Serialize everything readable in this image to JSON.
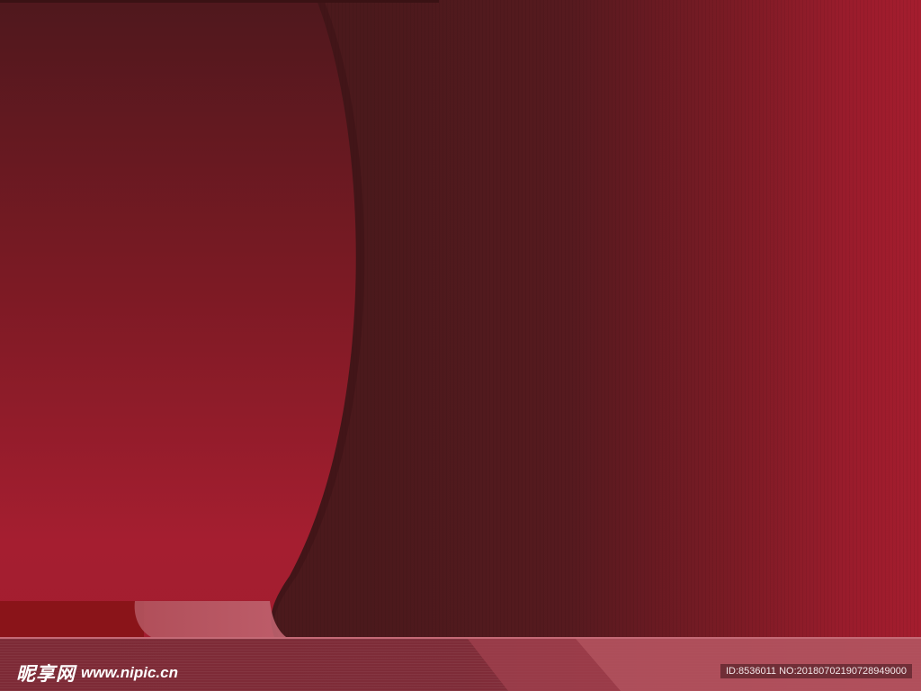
{
  "watermark": {
    "logo_text": "昵享网",
    "url_text": "www.nipic.cn"
  },
  "id_badge": {
    "text": "ID:8536011 NO:20180702190728949000"
  },
  "colors": {
    "curve_panel_top": "#4f181d",
    "curve_panel_bottom": "#a51e30",
    "stripe_field_left": "#4a1a1d",
    "stripe_field_right": "#a41d2e",
    "bottom_bar": "#7d2a36",
    "bottom_bar_highlight": "#c46a76"
  }
}
